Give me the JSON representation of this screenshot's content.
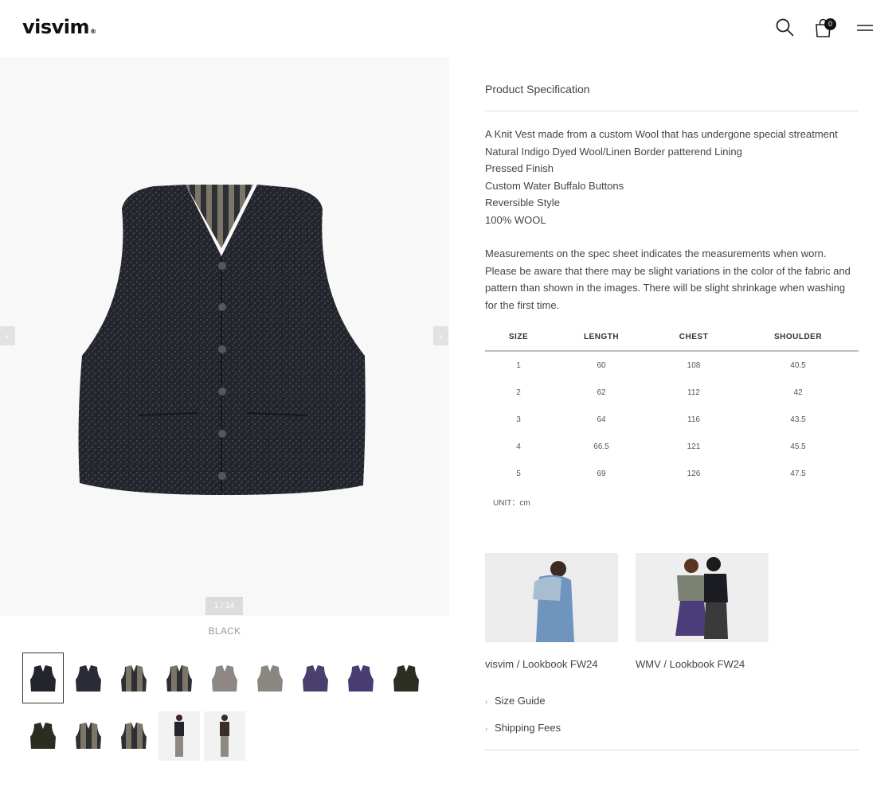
{
  "header": {
    "logo": "visvim",
    "logo_mark": "®",
    "cart_count": "0"
  },
  "icons": [
    "search-icon",
    "bag-icon",
    "menu-icon",
    "chevron-left-icon",
    "chevron-right-icon",
    "chevron-right-icon"
  ],
  "gallery": {
    "counter": "1 / 14",
    "color_label": "BLACK",
    "prev": "‹",
    "next": "›"
  },
  "spec": {
    "title": "Product Specification",
    "lines": [
      "A Knit Vest made from a custom Wool that has undergone special streatment",
      "Natural Indigo Dyed Wool/Linen Border patterend Lining",
      "Pressed Finish",
      "Custom Water Buffalo Buttons",
      "Reversible Style",
      "100% WOOL"
    ],
    "note": "Measurements on the spec sheet indicates the measurements when worn. Please be aware that there may be slight variations in the color of the fabric and pattern than shown in the images. There will be slight shrinkage when washing for the first time."
  },
  "size_table": {
    "headers": [
      "SIZE",
      "LENGTH",
      "CHEST",
      "SHOULDER"
    ],
    "rows": [
      [
        "1",
        "60",
        "108",
        "40.5"
      ],
      [
        "2",
        "62",
        "112",
        "42"
      ],
      [
        "3",
        "64",
        "116",
        "43.5"
      ],
      [
        "4",
        "66.5",
        "121",
        "45.5"
      ],
      [
        "5",
        "69",
        "126",
        "47.5"
      ]
    ],
    "unit": "UNIT：cm"
  },
  "lookbooks": [
    {
      "label": "visvim / Lookbook FW24"
    },
    {
      "label": "WMV / Lookbook FW24"
    }
  ],
  "links": {
    "size_guide": "Size Guide",
    "shipping_fees": "Shipping Fees"
  },
  "colors": {
    "accent": "#111111",
    "muted": "#9a9a9a",
    "gallery_bg": "#f8f8f8"
  }
}
